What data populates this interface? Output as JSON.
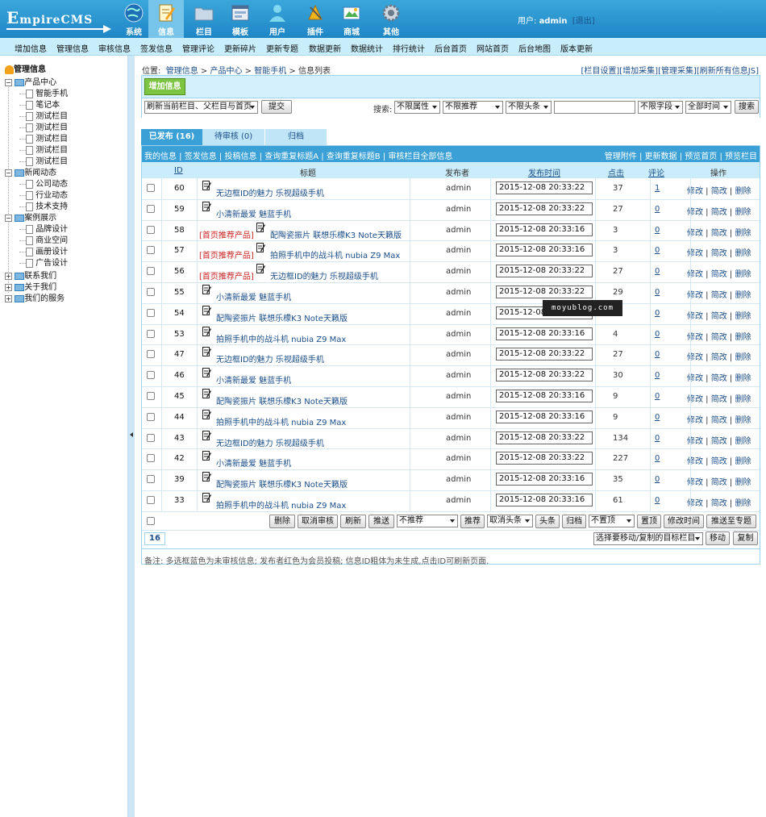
{
  "logo": {
    "main": "EmpireCMS",
    "big": "E",
    "rest": "mpireCMS"
  },
  "topnav": [
    {
      "label": "系统",
      "icon": "globe-icon"
    },
    {
      "label": "信息",
      "icon": "notepad-icon"
    },
    {
      "label": "栏目",
      "icon": "folder-icon"
    },
    {
      "label": "模板",
      "icon": "window-icon"
    },
    {
      "label": "用户",
      "icon": "user-icon"
    },
    {
      "label": "插件",
      "icon": "tools-icon"
    },
    {
      "label": "商城",
      "icon": "shop-icon"
    },
    {
      "label": "其他",
      "icon": "gear-icon"
    }
  ],
  "user": {
    "prefix": "用户:",
    "name": "admin",
    "logout": "[退出]"
  },
  "menu": [
    "增加信息",
    "管理信息",
    "审核信息",
    "签发信息",
    "管理评论",
    "更新碎片",
    "更新专题",
    "数据更新",
    "数据统计",
    "排行统计",
    "后台首页",
    "网站首页",
    "后台地图",
    "版本更新"
  ],
  "tree": {
    "root": "管理信息",
    "nodes": [
      "产品中心",
      "智能手机",
      "笔记本",
      "测试栏目",
      "测试栏目",
      "测试栏目",
      "测试栏目",
      "测试栏目",
      "新闻动态",
      "公司动态",
      "行业动态",
      "技术支持",
      "案例展示",
      "品牌设计",
      "商业空间",
      "画册设计",
      "广告设计",
      "联系我们",
      "关于我们",
      "我们的服务"
    ]
  },
  "breadcrumb": {
    "prefix": "位置:",
    "items": [
      "管理信息",
      "产品中心",
      "智能手机",
      "信息列表"
    ],
    "sep": " > "
  },
  "toplinks": [
    "[栏目设置]",
    "[增加采集]",
    "[管理采集]",
    "[刷新所有信息JS]"
  ],
  "add_button": "增加信息",
  "toolbar": {
    "refresh_select": "刷新当前栏目、父栏目与首页",
    "submit": "提交",
    "search_label": "搜索:",
    "attr": "不限属性",
    "recommend": "不限推荐",
    "headline": "不限头条",
    "field": "不限字段",
    "time": "全部时间",
    "search_btn": "搜索"
  },
  "tabs": [
    "已发布 (16)",
    "待审核 (0)",
    "归档"
  ],
  "sublinks_left": [
    "我的信息",
    "签发信息",
    "投稿信息",
    "查询重复标题A",
    "查询重复标题B",
    "审核栏目全部信息"
  ],
  "sublinks_right": [
    "管理附件",
    "更新数据",
    "预览首页",
    "预览栏目"
  ],
  "columns": {
    "id": "ID",
    "title": "标题",
    "publisher": "发布者",
    "time": "发布时间",
    "clicks": "点击",
    "comments": "评论",
    "ops": "操作"
  },
  "ops": [
    "修改",
    "简改",
    "删除"
  ],
  "rows": [
    {
      "id": "60",
      "tag": "",
      "title": "无边框ID的魅力 乐视超级手机",
      "pub": "admin",
      "time": "2015-12-08 20:33:22",
      "clicks": "37",
      "comments": "1"
    },
    {
      "id": "59",
      "tag": "",
      "title": "小清新最爱 魅蓝手机",
      "pub": "admin",
      "time": "2015-12-08 20:33:22",
      "clicks": "27",
      "comments": "0"
    },
    {
      "id": "58",
      "tag": "[首页推荐产品]",
      "title": "配陶瓷振片 联想乐檬K3 Note天籁版",
      "pub": "admin",
      "time": "2015-12-08 20:33:16",
      "clicks": "3",
      "comments": "0"
    },
    {
      "id": "57",
      "tag": "[首页推荐产品]",
      "title": "拍照手机中的战斗机 nubia Z9 Max",
      "pub": "admin",
      "time": "2015-12-08 20:33:16",
      "clicks": "3",
      "comments": "0"
    },
    {
      "id": "56",
      "tag": "[首页推荐产品]",
      "title": "无边框ID的魅力 乐视超级手机",
      "pub": "admin",
      "time": "2015-12-08 20:33:22",
      "clicks": "27",
      "comments": "0"
    },
    {
      "id": "55",
      "tag": "",
      "title": "小清新最爱 魅蓝手机",
      "pub": "admin",
      "time": "2015-12-08 20:33:22",
      "clicks": "29",
      "comments": "0"
    },
    {
      "id": "54",
      "tag": "",
      "title": "配陶瓷振片 联想乐檬K3 Note天籁版",
      "pub": "admin",
      "time": "2015-12-08 20:33:16",
      "clicks": "",
      "comments": "0"
    },
    {
      "id": "53",
      "tag": "",
      "title": "拍照手机中的战斗机 nubia Z9 Max",
      "pub": "admin",
      "time": "2015-12-08 20:33:16",
      "clicks": "4",
      "comments": "0"
    },
    {
      "id": "47",
      "tag": "",
      "title": "无边框ID的魅力 乐视超级手机",
      "pub": "admin",
      "time": "2015-12-08 20:33:22",
      "clicks": "27",
      "comments": "0"
    },
    {
      "id": "46",
      "tag": "",
      "title": "小清新最爱 魅蓝手机",
      "pub": "admin",
      "time": "2015-12-08 20:33:22",
      "clicks": "30",
      "comments": "0"
    },
    {
      "id": "45",
      "tag": "",
      "title": "配陶瓷振片 联想乐檬K3 Note天籁版",
      "pub": "admin",
      "time": "2015-12-08 20:33:16",
      "clicks": "9",
      "comments": "0"
    },
    {
      "id": "44",
      "tag": "",
      "title": "拍照手机中的战斗机 nubia Z9 Max",
      "pub": "admin",
      "time": "2015-12-08 20:33:16",
      "clicks": "9",
      "comments": "0"
    },
    {
      "id": "43",
      "tag": "",
      "title": "无边框ID的魅力 乐视超级手机",
      "pub": "admin",
      "time": "2015-12-08 20:33:22",
      "clicks": "134",
      "comments": "0"
    },
    {
      "id": "42",
      "tag": "",
      "title": "小清新最爱 魅蓝手机",
      "pub": "admin",
      "time": "2015-12-08 20:33:22",
      "clicks": "227",
      "comments": "0"
    },
    {
      "id": "39",
      "tag": "",
      "title": "配陶瓷振片 联想乐檬K3 Note天籁版",
      "pub": "admin",
      "time": "2015-12-08 20:33:16",
      "clicks": "35",
      "comments": "0"
    },
    {
      "id": "33",
      "tag": "",
      "title": "拍照手机中的战斗机 nubia Z9 Max",
      "pub": "admin",
      "time": "2015-12-08 20:33:16",
      "clicks": "61",
      "comments": "0"
    }
  ],
  "bottombar": {
    "delete": "删除",
    "cancel_review": "取消审核",
    "refresh": "刷新",
    "push": "推送",
    "no_recommend": "不推荐",
    "recommend": "推荐",
    "cancel_headline": "取消头条",
    "headline": "头条",
    "archive": "归档",
    "no_top": "不置顶",
    "top": "置顶",
    "modify_time": "修改时间",
    "push_topic": "推送至专题"
  },
  "pager": {
    "count": "16",
    "move_select": "选择要移动/复制的目标栏目",
    "move": "移动",
    "copy": "复制"
  },
  "note": "备注: 多选框蓝色为未审核信息; 发布者红色为会员投稿; 信息ID粗体为未生成,点击ID可刷新页面.",
  "watermark": "moyublog.com",
  "colors": {
    "header": "#2a97d2",
    "menu": "#c8eefb",
    "tab_active": "#3aa0d5",
    "tag_red": "#cc2222",
    "link": "#1b4f8a"
  }
}
